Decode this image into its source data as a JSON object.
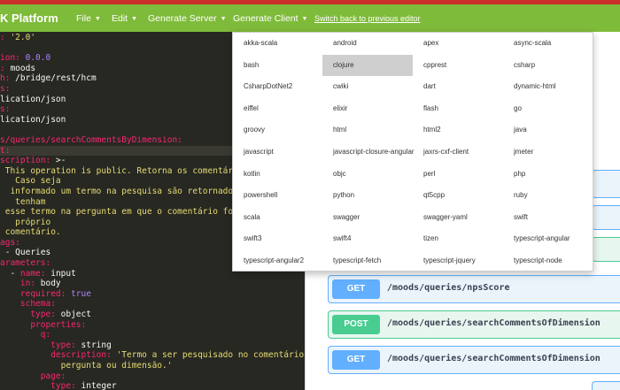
{
  "navbar": {
    "brand": "K Platform",
    "menus": [
      {
        "label": "File"
      },
      {
        "label": "Edit"
      },
      {
        "label": "Generate Server"
      },
      {
        "label": "Generate Client"
      }
    ],
    "switch_link": "Switch back to previous editor"
  },
  "editor": {
    "lines": [
      [
        {
          "c": "k",
          "t": ": "
        },
        {
          "c": "s",
          "t": "'2.0'"
        }
      ],
      [],
      [
        {
          "c": "k",
          "t": "ion: "
        },
        {
          "c": "n",
          "t": "0.0.0"
        }
      ],
      [
        {
          "c": "k",
          "t": ": "
        },
        {
          "c": "p",
          "t": "moods"
        }
      ],
      [
        {
          "c": "k",
          "t": "h: "
        },
        {
          "c": "p",
          "t": "/bridge/rest/hcm"
        }
      ],
      [
        {
          "c": "k",
          "t": "s:"
        }
      ],
      [
        {
          "c": "p",
          "t": "lication/json"
        }
      ],
      [
        {
          "c": "k",
          "t": "s:"
        }
      ],
      [
        {
          "c": "p",
          "t": "lication/json"
        }
      ],
      [],
      [
        {
          "c": "k",
          "t": "s/queries/searchCommentsByDimension:"
        }
      ],
      [
        {
          "c": "k",
          "t": "t:"
        }
      ],
      [
        {
          "c": "k",
          "t": "scription: "
        },
        {
          "c": "p",
          "t": ">-"
        }
      ],
      [
        {
          "c": "s",
          "t": " This operation is public. Retorna os comentários p"
        }
      ],
      [
        {
          "c": "s",
          "t": "   Caso seja"
        }
      ],
      [
        {
          "c": "s",
          "t": "  informado um termo na pesquisa são retornados os c"
        }
      ],
      [
        {
          "c": "s",
          "t": "   tenham"
        }
      ],
      [
        {
          "c": "s",
          "t": " esse termo na pergunta em que o comentário foi fei"
        }
      ],
      [
        {
          "c": "s",
          "t": "   próprio"
        }
      ],
      [
        {
          "c": "s",
          "t": " comentário."
        }
      ],
      [
        {
          "c": "k",
          "t": "ags:"
        }
      ],
      [
        {
          "c": "p",
          "t": " - Queries"
        }
      ],
      [
        {
          "c": "k",
          "t": "arameters:"
        }
      ],
      [
        {
          "c": "p",
          "t": "  - "
        },
        {
          "c": "k",
          "t": "name: "
        },
        {
          "c": "p",
          "t": "input"
        }
      ],
      [
        {
          "c": "k",
          "t": "    in: "
        },
        {
          "c": "p",
          "t": "body"
        }
      ],
      [
        {
          "c": "k",
          "t": "    required: "
        },
        {
          "c": "n",
          "t": "true"
        }
      ],
      [
        {
          "c": "k",
          "t": "    schema:"
        }
      ],
      [
        {
          "c": "k",
          "t": "      type: "
        },
        {
          "c": "p",
          "t": "object"
        }
      ],
      [
        {
          "c": "k",
          "t": "      properties:"
        }
      ],
      [
        {
          "c": "k",
          "t": "        q:"
        }
      ],
      [
        {
          "c": "k",
          "t": "          type: "
        },
        {
          "c": "p",
          "t": "string"
        }
      ],
      [
        {
          "c": "k",
          "t": "          description: "
        },
        {
          "c": "s",
          "t": "'Termo a ser pesquisado no comentário,"
        }
      ],
      [
        {
          "c": "s",
          "t": "            pergunta ou dimensão.'"
        }
      ],
      [
        {
          "c": "k",
          "t": "        page:"
        }
      ],
      [
        {
          "c": "k",
          "t": "          type: "
        },
        {
          "c": "p",
          "t": "integer"
        }
      ]
    ]
  },
  "operations": [
    {
      "method": "GET",
      "path": "/moods/queries/npsScore"
    },
    {
      "method": "POST",
      "path": "/moods/queries/searchCommentsOfDimension"
    },
    {
      "method": "GET",
      "path": "/moods/queries/searchCommentsOfDimension"
    }
  ],
  "colors": {
    "get": "#61affe",
    "post": "#49cc90",
    "navbar": "#7fbb3a",
    "topstrip": "#c9302c"
  },
  "generate_client_options": [
    "akka-scala",
    "android",
    "apex",
    "async-scala",
    "bash",
    "clojure",
    "cpprest",
    "csharp",
    "CsharpDotNet2",
    "cwiki",
    "dart",
    "dynamic-html",
    "eiffel",
    "elixir",
    "flash",
    "go",
    "groovy",
    "html",
    "html2",
    "java",
    "javascript",
    "javascript-closure-angular",
    "jaxrs-cxf-client",
    "jmeter",
    "kotlin",
    "objc",
    "perl",
    "php",
    "powershell",
    "python",
    "qt5cpp",
    "ruby",
    "scala",
    "swagger",
    "swagger-yaml",
    "swift",
    "swift3",
    "swift4",
    "tizen",
    "typescript-angular",
    "typescript-angular2",
    "typescript-fetch",
    "typescript-jquery",
    "typescript-node"
  ],
  "selected_option": "clojure"
}
